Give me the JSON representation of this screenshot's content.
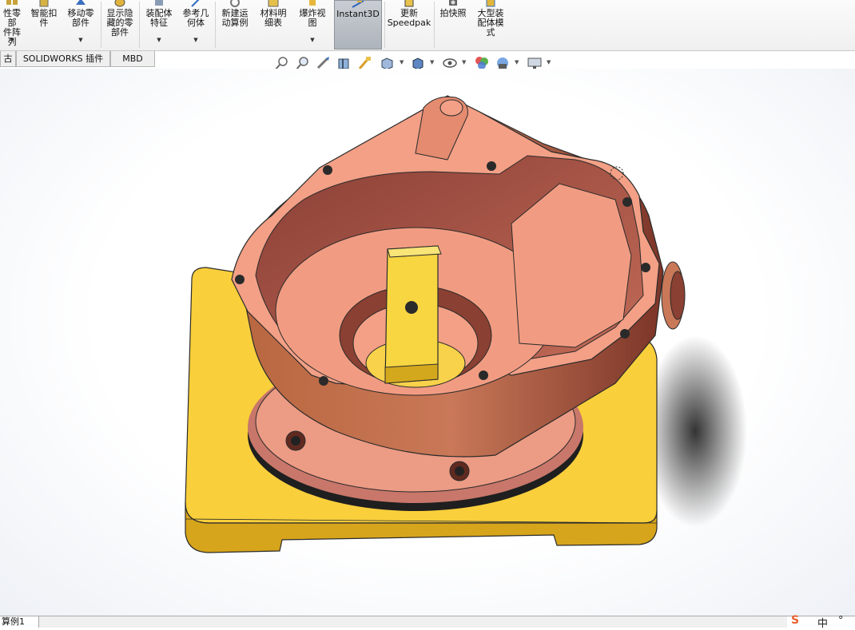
{
  "ribbon": {
    "buttons": [
      {
        "id": "linear-pattern",
        "label": "性零部\n件阵列"
      },
      {
        "id": "smart-fasteners",
        "label": "智能扣\n件"
      },
      {
        "id": "move-component",
        "label": "移动零\n部件"
      },
      {
        "id": "show-hidden",
        "label": "显示隐\n藏的零\n部件"
      },
      {
        "id": "assembly-features",
        "label": "装配体\n特征"
      },
      {
        "id": "reference-geometry",
        "label": "参考几\n何体"
      },
      {
        "id": "new-motion-study",
        "label": "新建运\n动算例"
      },
      {
        "id": "bom",
        "label": "材料明\n细表"
      },
      {
        "id": "exploded-view",
        "label": "爆炸视\n图"
      },
      {
        "id": "instant3d",
        "label": "Instant3D"
      },
      {
        "id": "update-speedpak",
        "label": "更新\nSpeedpak"
      },
      {
        "id": "snapshot",
        "label": "拍快照"
      },
      {
        "id": "large-assembly",
        "label": "大型装\n配体模\n式"
      }
    ]
  },
  "tabs": [
    {
      "label": "古"
    },
    {
      "label": "SOLIDWORKS 插件"
    },
    {
      "label": "MBD"
    }
  ],
  "hud_icons": [
    "zoom-to-fit-icon",
    "zoom-to-area-icon",
    "previous-view-icon",
    "section-view-icon",
    "dynamic-annotation-icon",
    "view-orientation-icon",
    "display-style-icon",
    "hide-show-items-icon",
    "edit-appearance-icon",
    "apply-scene-icon",
    "view-settings-icon"
  ],
  "bottom": {
    "motion_tab_label": "算例1",
    "tray_lang": "中",
    "tray_punct": "°"
  },
  "colors": {
    "housing": "#f09a7e",
    "housing_shadow": "#a55a48",
    "base_plate": "#f8cc3a",
    "base_plate_side": "#d9a81a",
    "key_block": "#f7d642"
  }
}
